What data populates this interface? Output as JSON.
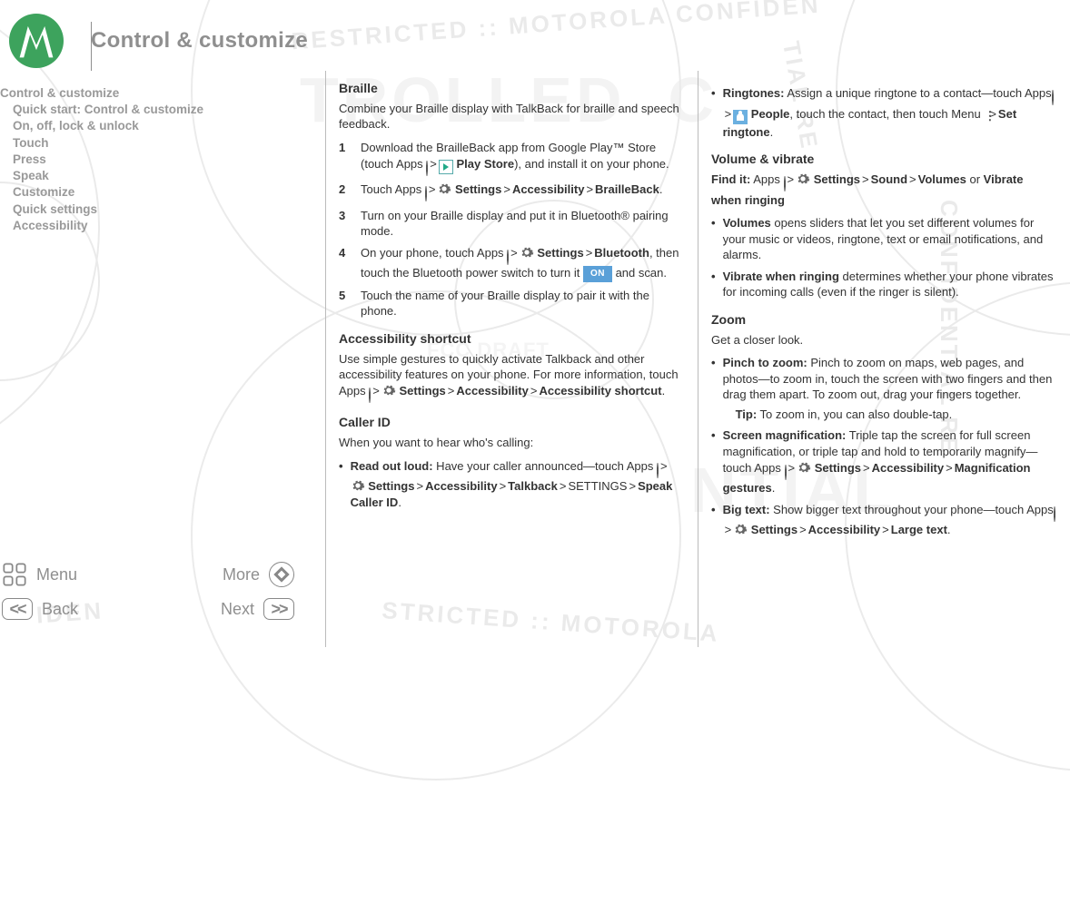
{
  "header": {
    "title": "Control & customize"
  },
  "toc": [
    {
      "label": "Control & customize",
      "level": 0
    },
    {
      "label": "Quick start: Control & customize",
      "level": 1
    },
    {
      "label": "On, off, lock & unlock",
      "level": 1
    },
    {
      "label": "Touch",
      "level": 1
    },
    {
      "label": "Press",
      "level": 1
    },
    {
      "label": "Speak",
      "level": 1
    },
    {
      "label": "Customize",
      "level": 1
    },
    {
      "label": "Quick settings",
      "level": 1
    },
    {
      "label": "Accessibility",
      "level": 1
    }
  ],
  "nav": {
    "menu": "Menu",
    "more": "More",
    "back": "Back",
    "next": "Next"
  },
  "strings": {
    "arrow": ">",
    "apps_word": "Apps",
    "settings": "Settings",
    "accessibility": "Accessibility",
    "play_store": "Play Store",
    "brailleback": "BrailleBack",
    "bluetooth": "Bluetooth",
    "on": "ON",
    "talkback": "Talkback",
    "settings_caps": "SETTINGS",
    "speak_caller_id": "Speak Caller ID",
    "people": "People",
    "set_ringtone": "Set ringtone",
    "find_it": "Find it:",
    "sound": "Sound",
    "volumes": "Volumes",
    "vibrate_when_ringing": "Vibrate when ringing",
    "tip": "Tip:",
    "accessibility_shortcut": "Accessibility shortcut",
    "magnification_gestures": "Magnification gestures",
    "large_text": "Large text",
    "menu_word": "Menu"
  },
  "col1": {
    "braille_h": "Braille",
    "braille_p": "Combine your Braille display with TalkBack for braille and speech feedback.",
    "s1a": "Download the BrailleBack app from Google Play™ Store (touch Apps ",
    "s1b": "), and install it on your phone.",
    "s2a": "Touch Apps ",
    "s3": "Turn on your Braille display and put it in Bluetooth® pairing mode.",
    "s4a": "On your phone, touch Apps ",
    "s4b": ", then touch the Bluetooth power switch to turn it ",
    "s4c": " and scan.",
    "s5": "Touch the name of your Braille display to pair it with the phone.",
    "acc_h": "Accessibility shortcut",
    "acc_p1": "Use simple gestures to quickly activate Talkback and other accessibility features on your phone. For more information, touch Apps ",
    "caller_h": "Caller ID",
    "caller_p": "When you want to hear who's calling:",
    "caller_b1_lead": "Read out loud:",
    "caller_b1_txt": " Have your caller announced—touch Apps "
  },
  "col2": {
    "ring_lead": "Ringtones:",
    "ring_txt1": " Assign a unique ringtone to a contact—touch Apps ",
    "ring_txt2": ", touch the contact, then touch Menu ",
    "vol_h": "Volume & vibrate",
    "vol_find_txt": " or ",
    "vol_b1_lead": "Volumes",
    "vol_b1_txt": " opens sliders that let you set different volumes for your music or videos, ringtone, text or email notifications, and alarms.",
    "vol_b2_lead": "Vibrate when ringing",
    "vol_b2_txt": " determines whether your phone vibrates for incoming calls (even if the ringer is silent).",
    "zoom_h": "Zoom",
    "zoom_p": "Get a closer look.",
    "zoom_b1_lead": "Pinch to zoom:",
    "zoom_b1_txt": " Pinch to zoom on maps, web pages, and photos—to zoom in, touch the screen with two fingers and then drag them apart. To zoom out, drag your fingers together.",
    "zoom_b1_tip": " To zoom in, you can also double-tap.",
    "zoom_b2_lead": "Screen magnification:",
    "zoom_b2_txt1": " Triple tap the screen for full screen magnification, or triple tap and hold to temporarily magnify—touch Apps ",
    "zoom_b3_lead": "Big text:",
    "zoom_b3_txt1": " Show bigger text throughout your phone—touch Apps "
  }
}
